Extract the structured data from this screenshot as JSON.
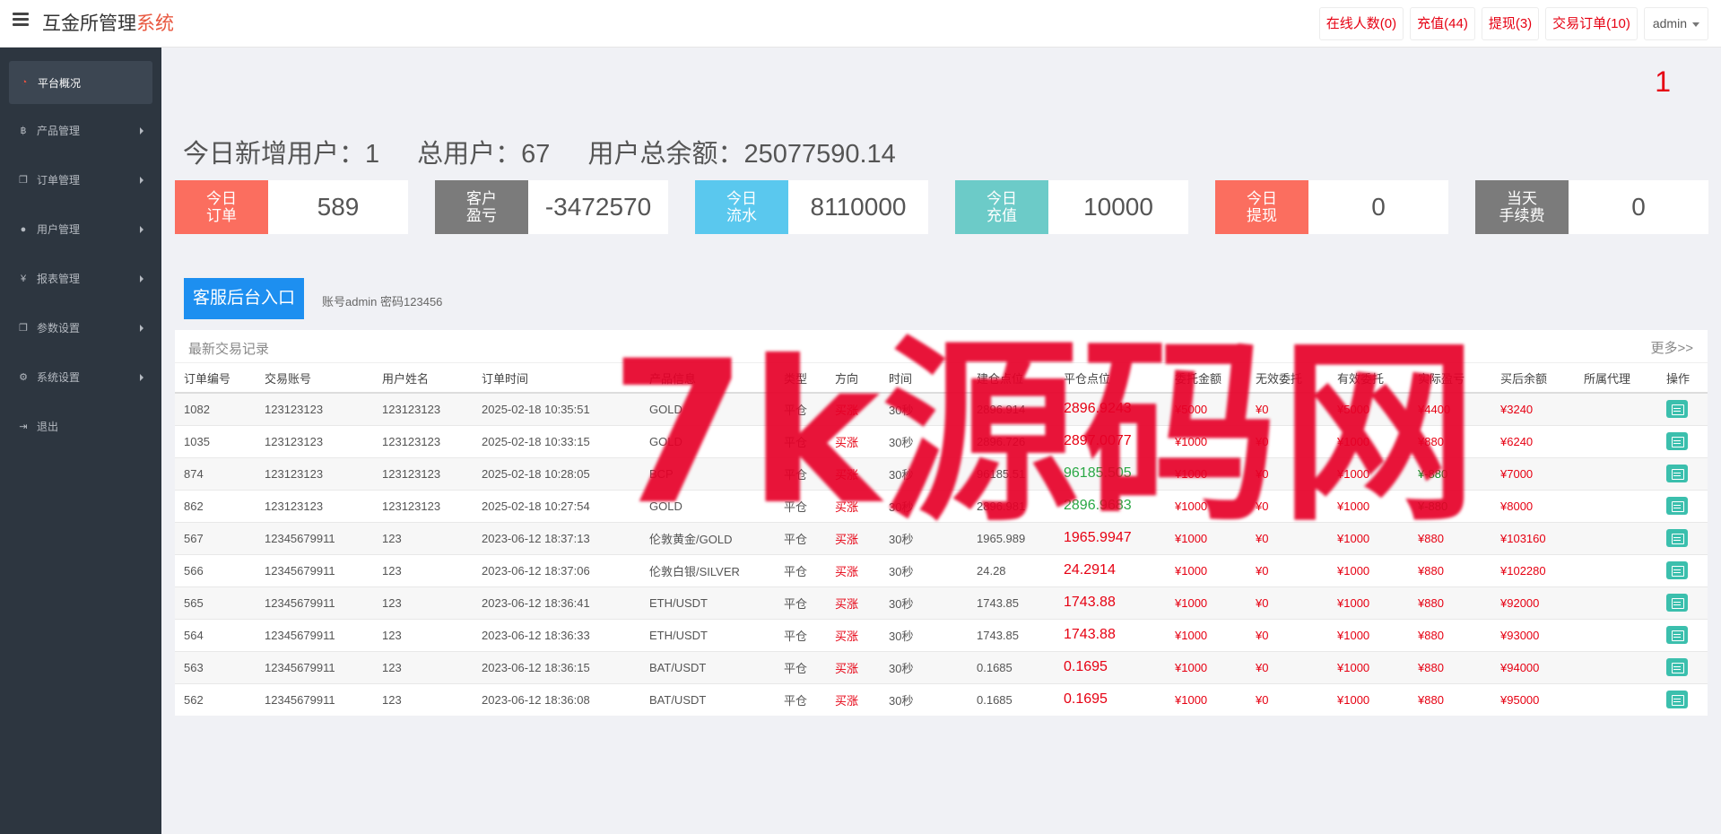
{
  "header": {
    "title_main": "互金所管理",
    "title_accent": "系统",
    "links": [
      {
        "label": "在线人数(0)"
      },
      {
        "label": "充值(44)"
      },
      {
        "label": "提现(3)"
      },
      {
        "label": "交易订单(10)"
      }
    ],
    "user": "admin"
  },
  "sidebar": {
    "items": [
      {
        "label": "平台概况",
        "icon": "dashboard-icon",
        "active": true
      },
      {
        "label": "产品管理",
        "icon": "bitcoin-icon"
      },
      {
        "label": "订单管理",
        "icon": "copy-icon"
      },
      {
        "label": "用户管理",
        "icon": "user-icon"
      },
      {
        "label": "报表管理",
        "icon": "yen-icon"
      },
      {
        "label": "参数设置",
        "icon": "copy-icon"
      },
      {
        "label": "系统设置",
        "icon": "gears-icon"
      },
      {
        "label": "退出",
        "icon": "sign-out-icon"
      }
    ]
  },
  "main": {
    "page_number": "1",
    "summary": {
      "new_users_label": "今日新增用户：",
      "new_users_value": "1",
      "total_users_label": "总用户：",
      "total_users_value": "67",
      "balance_label": "用户总余额：",
      "balance_value": "25077590.14"
    },
    "stats": [
      {
        "line1": "今日",
        "line2": "订单",
        "value": "589",
        "color": "#fb6e5f"
      },
      {
        "line1": "客户",
        "line2": "盈亏",
        "value": "-3472570",
        "color": "#7b7b7b"
      },
      {
        "line1": "今日",
        "line2": "流水",
        "value": "8110000",
        "color": "#5ac8ee"
      },
      {
        "line1": "今日",
        "line2": "充值",
        "value": "10000",
        "color": "#6ccbc8"
      },
      {
        "line1": "今日",
        "line2": "提现",
        "value": "0",
        "color": "#fb6e5f"
      },
      {
        "line1": "当天",
        "line2": "手续费",
        "value": "0",
        "color": "#7b7b7b"
      }
    ],
    "cs_button": "客服后台入口",
    "cs_note": "账号admin 密码123456",
    "table": {
      "title": "最新交易记录",
      "more": "更多>>",
      "columns": [
        "订单编号",
        "交易账号",
        "用户姓名",
        "订单时间",
        "产品信息",
        "类型",
        "方向",
        "时间",
        "建仓点位",
        "平仓点位",
        "委托金额",
        "无效委托",
        "有效委托",
        "实际盈亏",
        "买后余额",
        "所属代理",
        "操作"
      ],
      "rows": [
        {
          "id": "1082",
          "account": "123123123",
          "name": "123123123",
          "time": "2025-02-18 10:35:51",
          "product": "GOLD",
          "type": "平仓",
          "dir": "买涨",
          "period": "30秒",
          "open": "2896.914",
          "close": "2896.9243",
          "close_class": "close-red",
          "amount": "¥5000",
          "invalid": "¥0",
          "valid": "¥5000",
          "pnl": "¥4400",
          "pnl_class": "red",
          "balance": "¥3240",
          "agent": ""
        },
        {
          "id": "1035",
          "account": "123123123",
          "name": "123123123",
          "time": "2025-02-18 10:33:15",
          "product": "GOLD",
          "type": "平仓",
          "dir": "买涨",
          "period": "30秒",
          "open": "2896.726",
          "close": "2897.0077",
          "close_class": "close-red",
          "amount": "¥1000",
          "invalid": "¥0",
          "valid": "¥1000",
          "pnl": "¥880",
          "pnl_class": "red",
          "balance": "¥6240",
          "agent": ""
        },
        {
          "id": "874",
          "account": "123123123",
          "name": "123123123",
          "time": "2025-02-18 10:28:05",
          "product": "BCP",
          "type": "平仓",
          "dir": "买涨",
          "period": "30秒",
          "open": "96185.51",
          "close": "96185.505",
          "close_class": "close-green",
          "amount": "¥1000",
          "invalid": "¥0",
          "valid": "¥1000",
          "pnl": "¥-880",
          "pnl_class": "green",
          "balance": "¥7000",
          "agent": ""
        },
        {
          "id": "862",
          "account": "123123123",
          "name": "123123123",
          "time": "2025-02-18 10:27:54",
          "product": "GOLD",
          "type": "平仓",
          "dir": "买涨",
          "period": "30秒",
          "open": "2896.981",
          "close": "2896.9683",
          "close_class": "close-green",
          "amount": "¥1000",
          "invalid": "¥0",
          "valid": "¥1000",
          "pnl": "¥-880",
          "pnl_class": "green",
          "balance": "¥8000",
          "agent": ""
        },
        {
          "id": "567",
          "account": "12345679911",
          "name": "123",
          "time": "2023-06-12 18:37:13",
          "product": "伦敦黄金/GOLD",
          "type": "平仓",
          "dir": "买涨",
          "period": "30秒",
          "open": "1965.989",
          "close": "1965.9947",
          "close_class": "close-red",
          "amount": "¥1000",
          "invalid": "¥0",
          "valid": "¥1000",
          "pnl": "¥880",
          "pnl_class": "red",
          "balance": "¥103160",
          "agent": ""
        },
        {
          "id": "566",
          "account": "12345679911",
          "name": "123",
          "time": "2023-06-12 18:37:06",
          "product": "伦敦白银/SILVER",
          "type": "平仓",
          "dir": "买涨",
          "period": "30秒",
          "open": "24.28",
          "close": "24.2914",
          "close_class": "close-red",
          "amount": "¥1000",
          "invalid": "¥0",
          "valid": "¥1000",
          "pnl": "¥880",
          "pnl_class": "red",
          "balance": "¥102280",
          "agent": ""
        },
        {
          "id": "565",
          "account": "12345679911",
          "name": "123",
          "time": "2023-06-12 18:36:41",
          "product": "ETH/USDT",
          "type": "平仓",
          "dir": "买涨",
          "period": "30秒",
          "open": "1743.85",
          "close": "1743.88",
          "close_class": "close-red",
          "amount": "¥1000",
          "invalid": "¥0",
          "valid": "¥1000",
          "pnl": "¥880",
          "pnl_class": "red",
          "balance": "¥92000",
          "agent": ""
        },
        {
          "id": "564",
          "account": "12345679911",
          "name": "123",
          "time": "2023-06-12 18:36:33",
          "product": "ETH/USDT",
          "type": "平仓",
          "dir": "买涨",
          "period": "30秒",
          "open": "1743.85",
          "close": "1743.88",
          "close_class": "close-red",
          "amount": "¥1000",
          "invalid": "¥0",
          "valid": "¥1000",
          "pnl": "¥880",
          "pnl_class": "red",
          "balance": "¥93000",
          "agent": ""
        },
        {
          "id": "563",
          "account": "12345679911",
          "name": "123",
          "time": "2023-06-12 18:36:15",
          "product": "BAT/USDT",
          "type": "平仓",
          "dir": "买涨",
          "period": "30秒",
          "open": "0.1685",
          "close": "0.1695",
          "close_class": "close-red",
          "amount": "¥1000",
          "invalid": "¥0",
          "valid": "¥1000",
          "pnl": "¥880",
          "pnl_class": "red",
          "balance": "¥94000",
          "agent": ""
        },
        {
          "id": "562",
          "account": "12345679911",
          "name": "123",
          "time": "2023-06-12 18:36:08",
          "product": "BAT/USDT",
          "type": "平仓",
          "dir": "买涨",
          "period": "30秒",
          "open": "0.1685",
          "close": "0.1695",
          "close_class": "close-red",
          "amount": "¥1000",
          "invalid": "¥0",
          "valid": "¥1000",
          "pnl": "¥880",
          "pnl_class": "red",
          "balance": "¥95000",
          "agent": ""
        }
      ]
    }
  },
  "watermark": "7k源码网"
}
